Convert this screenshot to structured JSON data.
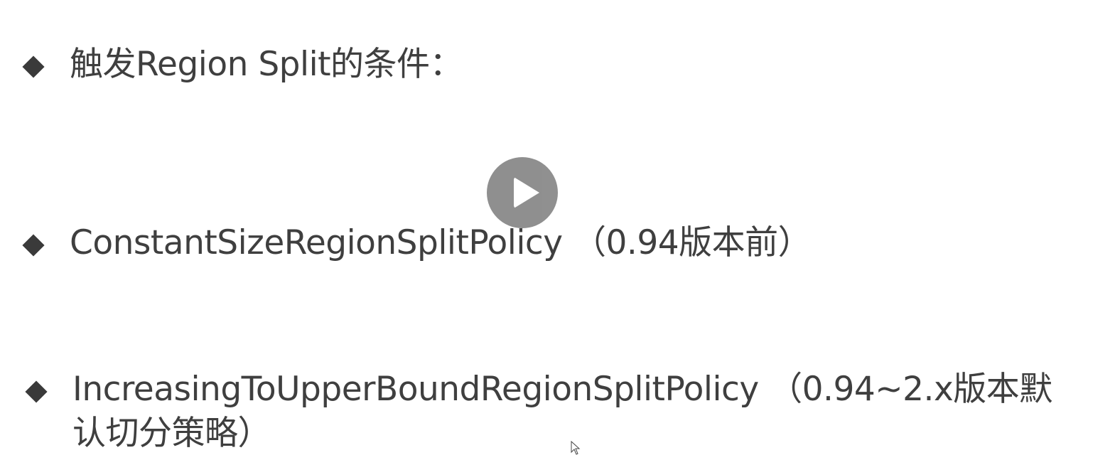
{
  "slide": {
    "bullets": [
      {
        "text": "触发Region Split的条件："
      },
      {
        "text": "ConstantSizeRegionSplitPolicy （0.94版本前）"
      },
      {
        "text": "IncreasingToUpperBoundRegionSplitPolicy （0.94~2.x版本默认切分策略）"
      }
    ]
  },
  "video": {
    "play_icon": "play-icon",
    "cursor_icon": "mouse-pointer-icon"
  }
}
